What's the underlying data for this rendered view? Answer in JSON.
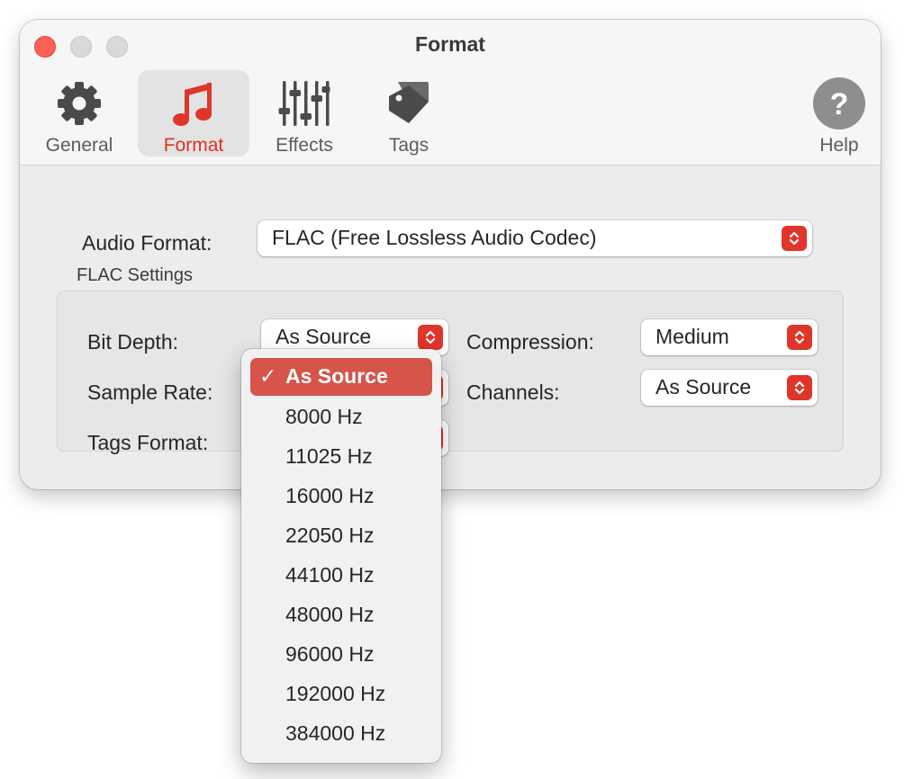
{
  "window": {
    "title": "Format"
  },
  "toolbar": {
    "general": "General",
    "format": "Format",
    "effects": "Effects",
    "tags": "Tags",
    "help": "Help"
  },
  "audio_format": {
    "label": "Audio Format:",
    "value": "FLAC (Free Lossless Audio Codec)"
  },
  "flac": {
    "group_title": "FLAC Settings",
    "bit_depth": {
      "label": "Bit Depth:",
      "value": "As Source"
    },
    "sample_rate": {
      "label": "Sample Rate:"
    },
    "tags_format": {
      "label": "Tags Format:"
    },
    "compression": {
      "label": "Compression:",
      "value": "Medium"
    },
    "channels": {
      "label": "Channels:",
      "value": "As Source"
    }
  },
  "sample_rate_menu": {
    "check_mark": "✓",
    "options": [
      "As Source",
      "8000 Hz",
      "11025 Hz",
      "16000 Hz",
      "22050 Hz",
      "44100 Hz",
      "48000 Hz",
      "96000 Hz",
      "192000 Hz",
      "384000 Hz"
    ],
    "selected_index": 0
  },
  "colors": {
    "accent": "#e0352b",
    "highlight": "#d6544a",
    "window_bg": "#ececec"
  },
  "icons": [
    "gear-icon",
    "music-note-icon",
    "sliders-icon",
    "tag-icon",
    "help-icon",
    "chevron-up-down-icon"
  ]
}
